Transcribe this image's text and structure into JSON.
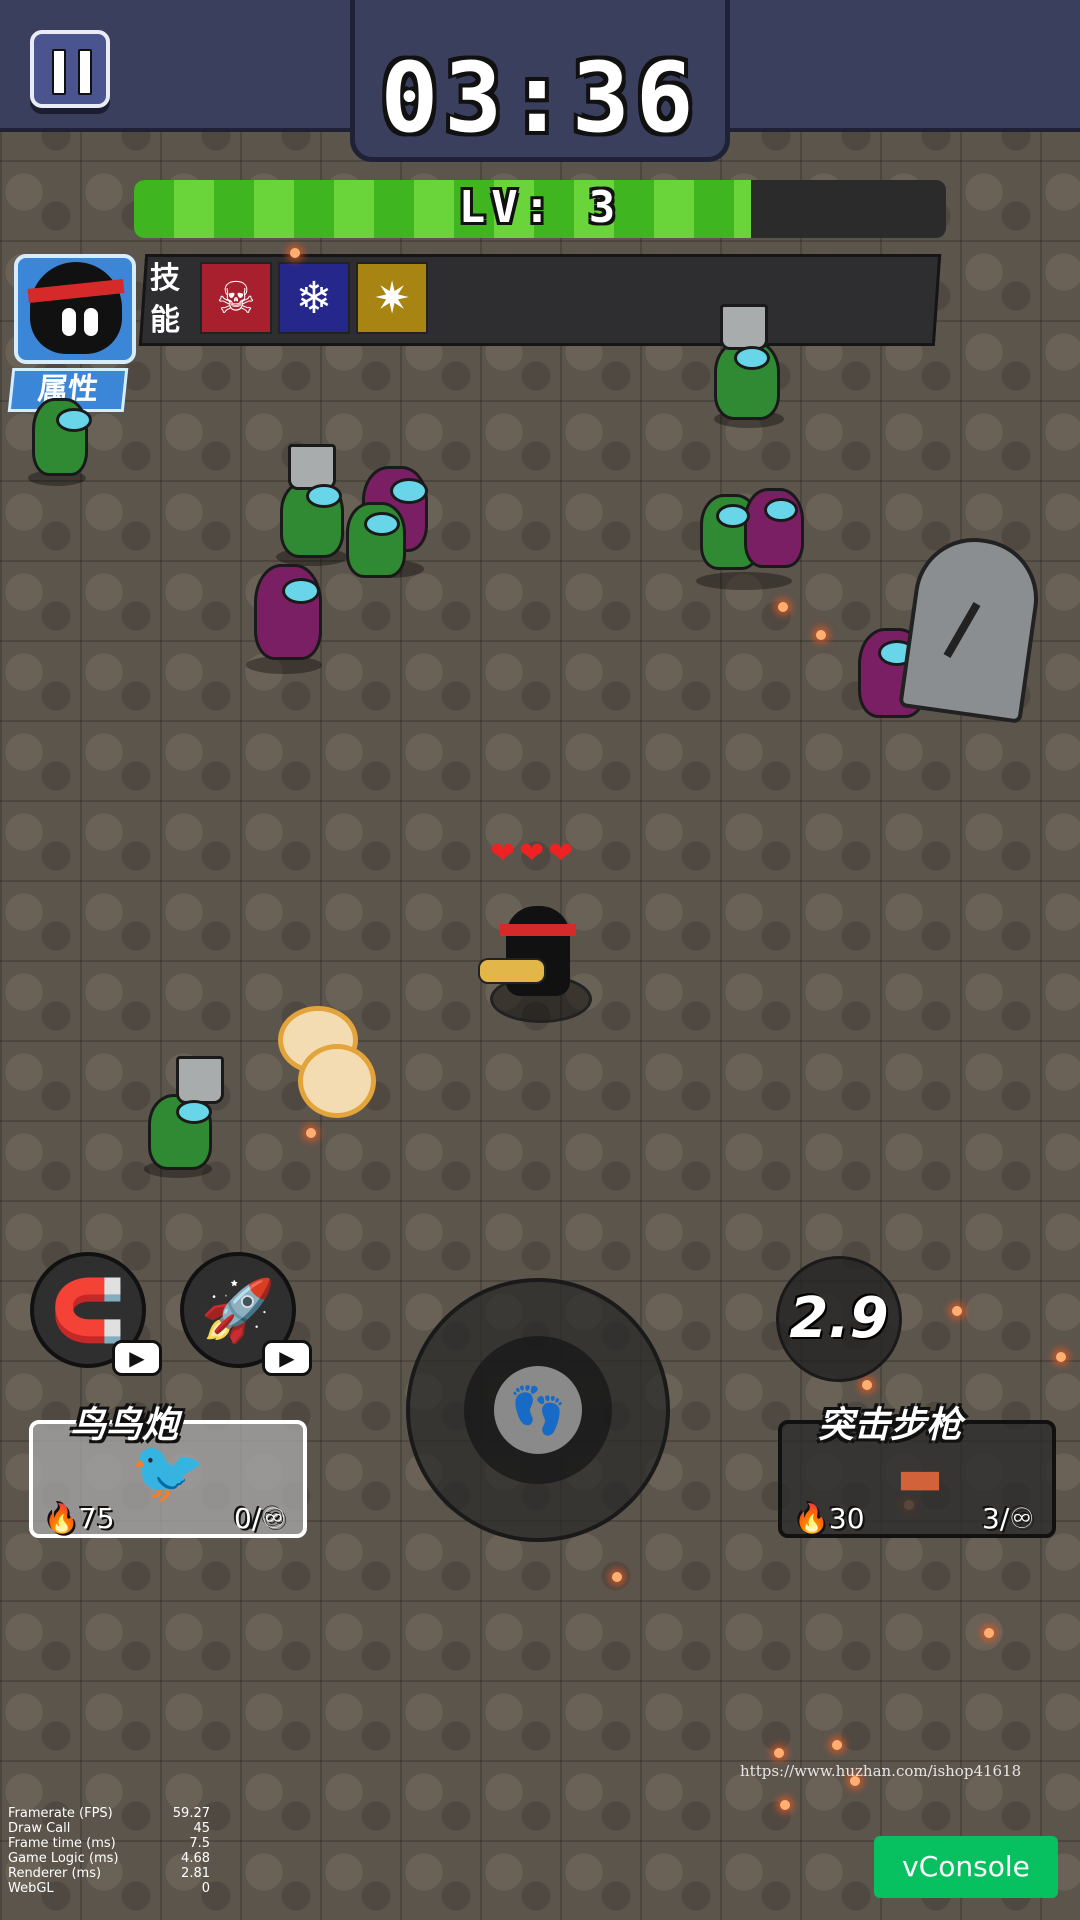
{
  "hud": {
    "timer": "03:36",
    "level_label": "LV: 3",
    "level_progress": 0.76,
    "skills_label": "技能",
    "attributes_button": "属性",
    "skills": [
      {
        "icon": "fang-roar-icon",
        "glyph": "☠",
        "color": "#a8202e"
      },
      {
        "icon": "snowflake-icon",
        "glyph": "❄",
        "color": "#25288a"
      },
      {
        "icon": "spike-burst-icon",
        "glyph": "✷",
        "color": "#a88412"
      }
    ],
    "player_hearts": "❤❤❤"
  },
  "abilities": [
    {
      "icon": "magnet-icon",
      "glyph": "🧲"
    },
    {
      "icon": "bullet-rocket-icon",
      "glyph": "🚀"
    }
  ],
  "cooldown_value": "2.9",
  "weapons": [
    {
      "name": "鸟鸟炮",
      "cost": "75",
      "ammo": "0/♾",
      "selected": true
    },
    {
      "name": "突击步枪",
      "cost": "30",
      "ammo": "3/♾",
      "selected": false
    }
  ],
  "watermark": "https://www.huzhan.com/ishop41618",
  "perf_stats": [
    {
      "label": "Framerate (FPS)",
      "value": "59.27"
    },
    {
      "label": "Draw Call",
      "value": "45"
    },
    {
      "label": "Frame time (ms)",
      "value": "7.5"
    },
    {
      "label": "Game Logic (ms)",
      "value": "4.68"
    },
    {
      "label": "Renderer (ms)",
      "value": "2.81"
    },
    {
      "label": "WebGL",
      "value": "0"
    }
  ],
  "vconsole_label": "vConsole",
  "colors": {
    "level_fill": "#3fb51f",
    "top_bar": "#3a3f5e",
    "vconsole": "#07c160",
    "enemy_green": "#2f8a33",
    "enemy_purple": "#7a1f63"
  }
}
